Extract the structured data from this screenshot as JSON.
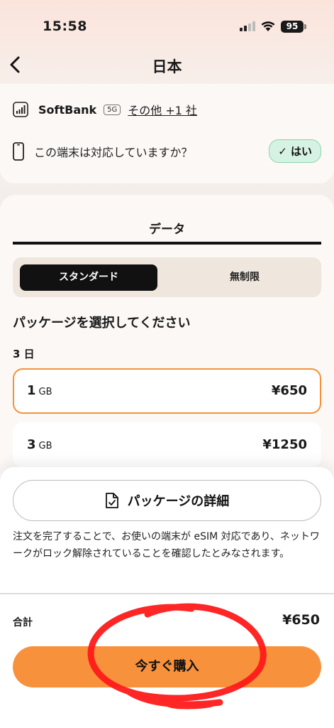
{
  "status_bar": {
    "time": "15:58",
    "battery": "95"
  },
  "nav": {
    "title": "日本"
  },
  "carrier": {
    "name": "SoftBank",
    "network_badge": "5G",
    "more_link": "その他 +1 社",
    "compat_question": "この端末は対応していますか？",
    "compat_answer": "✓ はい"
  },
  "data_tab": {
    "label": "データ"
  },
  "plan_toggle": {
    "options": [
      "スタンダード",
      "無制限"
    ],
    "selected": "スタンダード"
  },
  "package_section": {
    "title": "パッケージを選択してください",
    "duration": "3 日",
    "packages": [
      {
        "amount": "1",
        "unit": "GB",
        "price": "¥650",
        "selected": true
      },
      {
        "amount": "3",
        "unit": "GB",
        "price": "¥1250",
        "selected": false
      }
    ]
  },
  "bottom_sheet": {
    "details_button": "パッケージの詳細",
    "notice": "注文を完了することで、お使いの端末が eSIM 対応であり、ネットワークがロック解除されていることを確認したとみなされます。",
    "total_label": "合計",
    "total_price": "¥650",
    "buy_button": "今すぐ購入"
  },
  "colors": {
    "accent": "#f7913c",
    "selected_border": "#f5913a",
    "yes_badge_bg": "#d5f2e2",
    "annotation": "#ff1a1a"
  }
}
